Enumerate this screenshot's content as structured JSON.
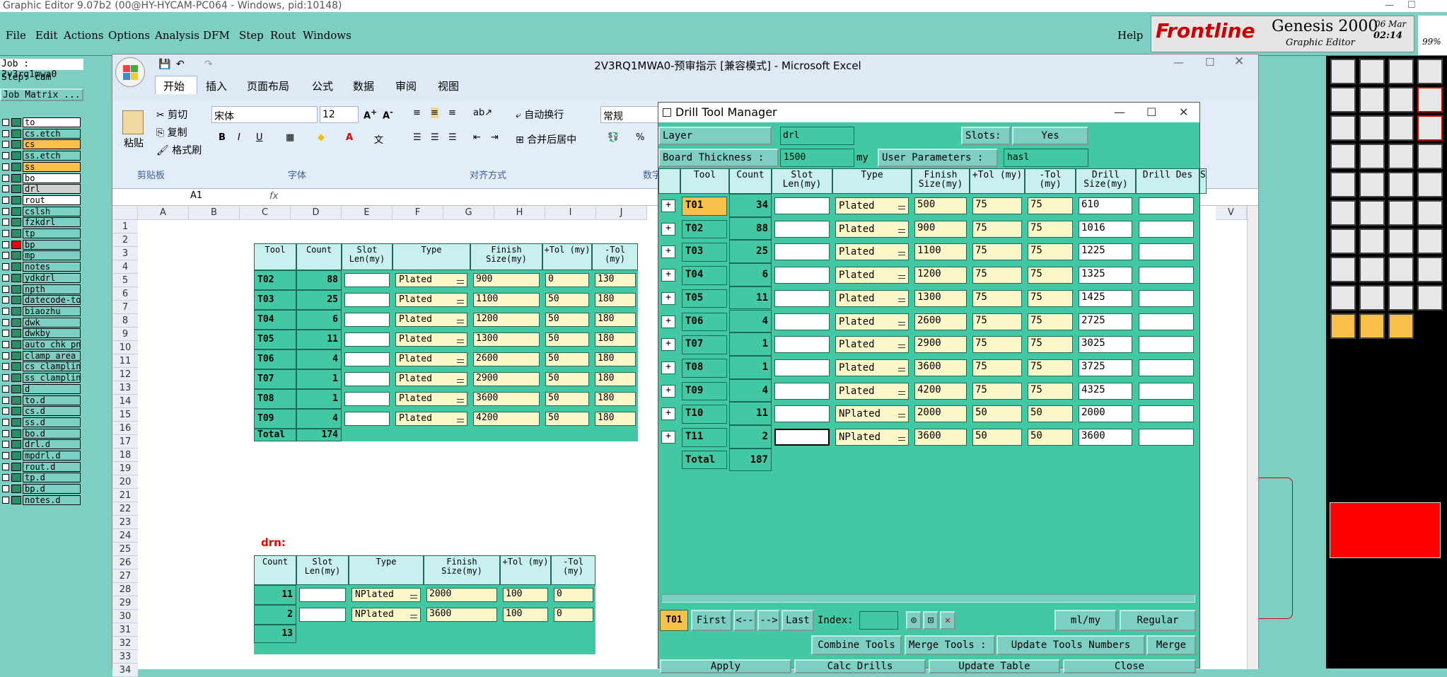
{
  "titlebar": {
    "text": "Graphic Editor 9.07b2 (00@HY-HYCAM-PC064 - Windows, pid:10148)"
  },
  "genesis_menu": [
    "File",
    "Edit",
    "Actions",
    "Options",
    "Analysis",
    "DFM",
    "Step",
    "Rout",
    "Windows"
  ],
  "help": "Help",
  "logo": {
    "brand": "Frontline",
    "product": "Genesis 2000",
    "sub": "Graphic Editor",
    "date": "06 Mar",
    "time": "02:14",
    "zoom": "99%"
  },
  "job": {
    "job": "Job : 2v3rq1mwa0",
    "step": "Step: cam",
    "matrix": "Job Matrix ..."
  },
  "layers": [
    "to",
    "cs.etch",
    "cs",
    "ss.etch",
    "ss",
    "bo",
    "drl",
    "rout",
    "cslsh",
    "fzkdrl",
    "tp",
    "bp",
    "mp",
    "notes",
    "ydkdrl",
    "npth",
    "datecode-to",
    "biaozhu",
    "dwk",
    "dwkby",
    "auto_chk_pn",
    "clamp_area",
    "cs_clampline",
    "ss_clampline",
    "d",
    "to.d",
    "cs.d",
    "ss.d",
    "bo.d",
    "drl.d",
    "mpdrl.d",
    "rout.d",
    "tp.d",
    "bp.d",
    "notes.d"
  ],
  "excel": {
    "title": "2V3RQ1MWA0-预审指示 [兼容模式] - Microsoft Excel",
    "tabs": [
      "开始",
      "插入",
      "页面布局",
      "公式",
      "数据",
      "审阅",
      "视图"
    ],
    "clipboard": {
      "paste": "粘贴",
      "cut": "剪切",
      "copy": "复制",
      "painter": "格式刷",
      "group": "剪贴板"
    },
    "font": {
      "name": "宋体",
      "size": "12",
      "group": "字体"
    },
    "align": {
      "wrap": "自动换行",
      "merge": "合并后居中",
      "group": "对齐方式"
    },
    "number": {
      "format": "常规",
      "group": "数字"
    },
    "namebox": "A1",
    "fx": "fx",
    "cols": [
      "A",
      "B",
      "C",
      "D",
      "E",
      "F",
      "G",
      "H",
      "I",
      "J",
      "V"
    ],
    "rows": [
      "1",
      "2",
      "3",
      "4",
      "5",
      "6",
      "7",
      "8",
      "9",
      "10",
      "11",
      "12",
      "13",
      "14",
      "15",
      "16",
      "17",
      "18",
      "19",
      "20",
      "21",
      "22",
      "23",
      "24",
      "25",
      "26",
      "27",
      "28",
      "29",
      "30",
      "31",
      "32",
      "33",
      "34"
    ],
    "drn_label": "drn:",
    "t1_headers": [
      "Tool",
      "Count",
      "Slot Len(my)",
      "Type",
      "Finish Size(my)",
      "+Tol (my)",
      "-Tol (my)"
    ],
    "t1_rows": [
      [
        "T02",
        "88",
        "Plated",
        "900",
        "0",
        "130"
      ],
      [
        "T03",
        "25",
        "Plated",
        "1100",
        "50",
        "180"
      ],
      [
        "T04",
        "6",
        "Plated",
        "1200",
        "50",
        "180"
      ],
      [
        "T05",
        "11",
        "Plated",
        "1300",
        "50",
        "180"
      ],
      [
        "T06",
        "4",
        "Plated",
        "2600",
        "50",
        "180"
      ],
      [
        "T07",
        "1",
        "Plated",
        "2900",
        "50",
        "180"
      ],
      [
        "T08",
        "1",
        "Plated",
        "3600",
        "50",
        "180"
      ],
      [
        "T09",
        "4",
        "Plated",
        "4200",
        "50",
        "180"
      ]
    ],
    "t1_total": [
      "Total",
      "174"
    ],
    "t2_headers": [
      "Count",
      "Slot Len(my)",
      "Type",
      "Finish Size(my)",
      "+Tol (my)",
      "-Tol (my)"
    ],
    "t2_rows": [
      [
        "11",
        "NPlated",
        "2000",
        "100",
        "0"
      ],
      [
        "2",
        "NPlated",
        "3600",
        "100",
        "0"
      ]
    ],
    "t2_total": "13"
  },
  "dtm": {
    "title": "Drill Tool Manager",
    "layer_label": "Layer",
    "layer_value": "drl",
    "slots_label": "Slots:",
    "slots_value": "Yes",
    "thick_label": "Board Thickness :",
    "thick_value": "1500",
    "thick_unit": "my",
    "userparam_label": "User Parameters :",
    "userparam_value": "hasl",
    "headers": [
      "Tool",
      "Count",
      "Slot Len(my)",
      "Type",
      "Finish Size(my)",
      "+Tol (my)",
      "-Tol (my)",
      "Drill Size(my)",
      "Drill Des",
      "S"
    ],
    "rows": [
      [
        "T01",
        "34",
        "Plated",
        "500",
        "75",
        "75",
        "610"
      ],
      [
        "T02",
        "88",
        "Plated",
        "900",
        "75",
        "75",
        "1016"
      ],
      [
        "T03",
        "25",
        "Plated",
        "1100",
        "75",
        "75",
        "1225"
      ],
      [
        "T04",
        "6",
        "Plated",
        "1200",
        "75",
        "75",
        "1325"
      ],
      [
        "T05",
        "11",
        "Plated",
        "1300",
        "75",
        "75",
        "1425"
      ],
      [
        "T06",
        "4",
        "Plated",
        "2600",
        "75",
        "75",
        "2725"
      ],
      [
        "T07",
        "1",
        "Plated",
        "2900",
        "75",
        "75",
        "3025"
      ],
      [
        "T08",
        "1",
        "Plated",
        "3600",
        "75",
        "75",
        "3725"
      ],
      [
        "T09",
        "4",
        "Plated",
        "4200",
        "75",
        "75",
        "4325"
      ],
      [
        "T10",
        "11",
        "NPlated",
        "2000",
        "50",
        "50",
        "2000"
      ],
      [
        "T11",
        "2",
        "NPlated",
        "3600",
        "50",
        "50",
        "3600"
      ]
    ],
    "total": [
      "Total",
      "187"
    ],
    "nav": {
      "current": "T01",
      "first": "First",
      "prev": "<--",
      "next": "-->",
      "last": "Last",
      "index": "Index:",
      "units": "ml/my",
      "mode": "Regular"
    },
    "actions": {
      "combine": "Combine Tools",
      "merge_label": "Merge Tools :",
      "merge_value": "Update Tools Numbers",
      "merge": "Merge"
    },
    "bottom": [
      "Apply",
      "Calc Drills",
      "Update Table",
      "Close"
    ]
  }
}
